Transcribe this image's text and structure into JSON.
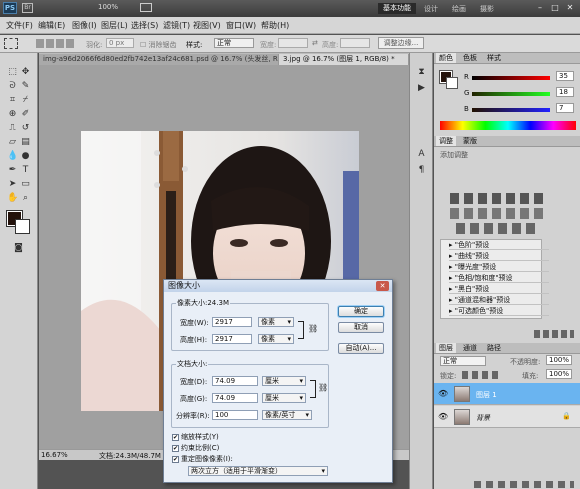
{
  "titlebar": {
    "ps_logo": "PS",
    "zoom_value": "100%",
    "workspace_active": "基本功能",
    "workspaces": [
      "设计",
      "绘画",
      "摄影"
    ]
  },
  "menu": [
    "文件(F)",
    "编辑(E)",
    "图像(I)",
    "图层(L)",
    "选择(S)",
    "滤镜(T)",
    "视图(V)",
    "窗口(W)",
    "帮助(H)"
  ],
  "options": {
    "feather_label": "羽化:",
    "feather_value": "0 px",
    "antialias_label": "消除锯齿",
    "style_label": "样式:",
    "style_value": "正常",
    "width_label": "宽度:",
    "height_label": "高度:",
    "refine_edge": "调整边缘..."
  },
  "tabs": [
    "img-a96d2066f6d80ed2fb742e13af24c681.psd @ 16.7% (头发丝, RGB...",
    "3.jpg @ 16.7% (图层 1, RGB/8) *"
  ],
  "status": {
    "zoom": "16.67%",
    "doc": "文档:24.3M/48.7M"
  },
  "color_panel": {
    "tabs": [
      "颜色",
      "色板",
      "样式"
    ],
    "r_label": "R",
    "g_label": "G",
    "b_label": "B",
    "r": "35",
    "g": "18",
    "b": "7",
    "foreground": "#23120b"
  },
  "adjust_panel": {
    "tabs": [
      "调整",
      "蒙版"
    ],
    "title": "添加调整",
    "presets": [
      "\"色阶\"预设",
      "\"曲线\"预设",
      "\"曝光度\"预设",
      "\"色相/饱和度\"预设",
      "\"黑白\"预设",
      "\"通道混和器\"预设",
      "\"可选颜色\"预设"
    ]
  },
  "layers_panel": {
    "tabs": [
      "图层",
      "通道",
      "路径"
    ],
    "blend_mode": "正常",
    "opacity_label": "不透明度:",
    "opacity": "100%",
    "lock_label": "锁定:",
    "fill_label": "填充:",
    "fill": "100%",
    "layers": [
      {
        "name": "图层 1",
        "selected": true
      },
      {
        "name": "背景",
        "selected": false
      }
    ]
  },
  "dialog": {
    "title": "图像大小",
    "pixel_group": "像素大小:24.3M",
    "width_label": "宽度(W):",
    "width_value": "2917",
    "width_unit": "像素",
    "height_label": "高度(H):",
    "height_value": "2917",
    "height_unit": "像素",
    "doc_group": "文档大小:",
    "doc_width_label": "宽度(D):",
    "doc_width_value": "74.09",
    "doc_width_unit": "厘米",
    "doc_height_label": "高度(G):",
    "doc_height_value": "74.09",
    "doc_height_unit": "厘米",
    "resolution_label": "分辨率(R):",
    "resolution_value": "100",
    "resolution_unit": "像素/英寸",
    "ok": "确定",
    "cancel": "取消",
    "auto": "自动(A)...",
    "scale_styles": "缩放样式(Y)",
    "constrain": "约束比例(C)",
    "resample": "重定图像像素(I):",
    "resample_method": "两次立方（适用于平滑渐变）"
  }
}
